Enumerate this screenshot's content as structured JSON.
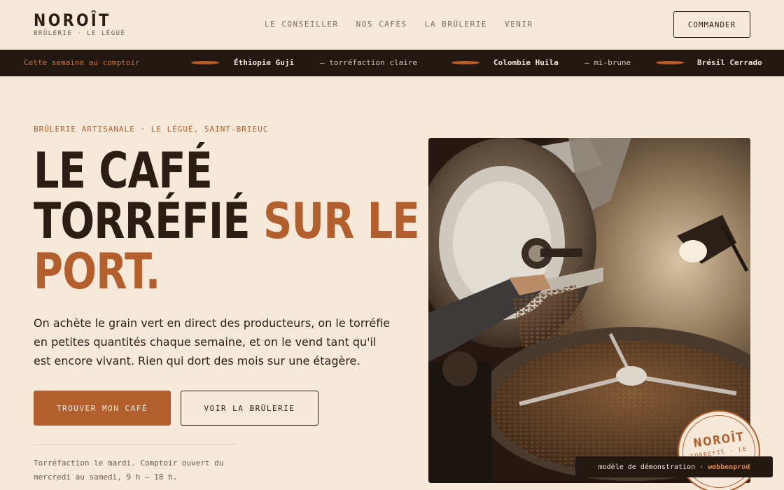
{
  "header": {
    "logo_name": "NOROÎT",
    "logo_sub": "BRÛLERIE · LE LÉGUÉ",
    "nav": [
      "LE CONSEILLER",
      "NOS CAFÉS",
      "LA BRÛLERIE",
      "VENIR"
    ],
    "order_label": "COMMANDER"
  },
  "ticker": {
    "label": "Cette semaine au comptoir",
    "items": [
      {
        "name": "Éthiopie Guji",
        "desc": "— torréfaction claire"
      },
      {
        "name": "Colombie Huila",
        "desc": "— mi-brune"
      },
      {
        "name": "Brésil Cerrado",
        "desc": ""
      }
    ]
  },
  "hero": {
    "kicker": "BRÛLERIE ARTISANALE · LE LÉGUÉ, SAINT-BRIEUC",
    "headline_line1": "LE CAFÉ",
    "headline_line2_dark": "TORRÉFIÉ",
    "headline_line2_accent": "SUR LE",
    "headline_line3_accent": "PORT.",
    "lede": "On achète le grain vert en direct des producteurs, on le torréfie en petites quantités chaque semaine, et on le vend tant qu'il est encore vivant. Rien qui dort des mois sur une étagère.",
    "primary_cta": "TROUVER MON CAFÉ",
    "secondary_cta": "VOIR LA BRÛLERIE",
    "hours": "Torréfaction le mardi. Comptoir ouvert du mercredi au samedi, 9 h – 18 h."
  },
  "stamp": {
    "name": "NOROÎT",
    "sub": "TORRÉFIÉ · LE"
  },
  "demo_badge": {
    "text": "modèle de démonstration ·",
    "brand": "webbenprod"
  },
  "icons": {
    "photo": "coffee-roaster-photo",
    "ticker_separator": "coffee-bean-icon"
  },
  "colors": {
    "background": "#f6e9da",
    "ink": "#2b1d14",
    "accent": "#b35f2d",
    "ticker_bg": "#231711"
  }
}
